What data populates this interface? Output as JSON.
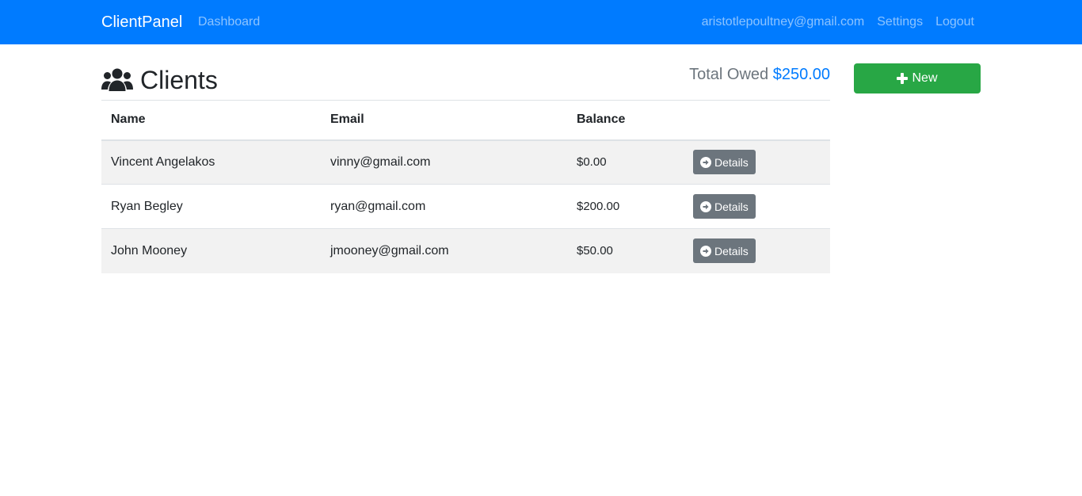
{
  "navbar": {
    "brand": "ClientPanel",
    "dashboard_link": "Dashboard",
    "user_email": "aristotlepoultney@gmail.com",
    "settings_link": "Settings",
    "logout_link": "Logout",
    "background_color": "#007bff"
  },
  "header": {
    "title": "Clients",
    "title_icon": "users-icon",
    "total_owed_label": "Total Owed",
    "total_owed_value": "$250.00"
  },
  "new_button": {
    "label": "New",
    "icon": "plus-icon",
    "color": "#28a745"
  },
  "table": {
    "columns": [
      "Name",
      "Email",
      "Balance"
    ],
    "details_label": "Details",
    "details_icon": "arrow-circle-right-icon",
    "rows": [
      {
        "name": "Vincent Angelakos",
        "email": "vinny@gmail.com",
        "balance": "$0.00"
      },
      {
        "name": "Ryan Begley",
        "email": "ryan@gmail.com",
        "balance": "$200.00"
      },
      {
        "name": "John Mooney",
        "email": "jmooney@gmail.com",
        "balance": "$50.00"
      }
    ]
  }
}
